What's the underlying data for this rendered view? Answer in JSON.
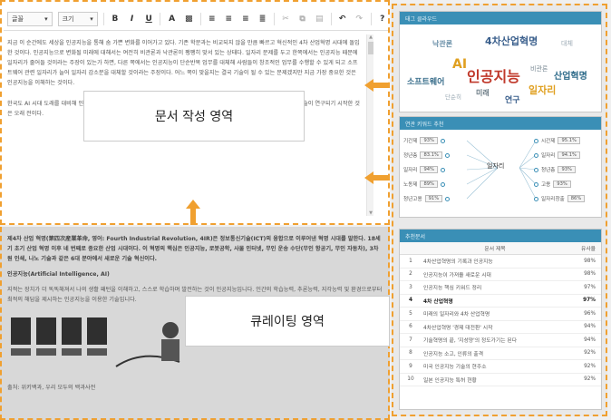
{
  "toolbar": {
    "font_select": "글꼴",
    "size_select": "크기",
    "bold": "B",
    "italic": "I",
    "underline": "U",
    "font_color": "A",
    "help": "?"
  },
  "editor": {
    "paragraphs": [
      "지금 이 순간에도 세상을 인공지능을 통해 숨 가쁜 변화를 이어가고 있다. 기존 학문과는 비교되지 않을 만큼 빠르고 혁신적인 4차 산업혁명 시대에 돌입한 것이다. 인공지능으로 변화될 미래에 대해서는 여전히 비관론과 낙관론이 팽팽히 맞서 있는 상태다. 일자리 문제를 두고 한쪽에서는 인공지능 때문에 일자리가 줄어들 것이라는 주장이 있는가 하면, 다른 쪽에서는 인공지능이 단순반복 업무를 대체해 사람들이 창조적인 업무를 수행할 수 있게 되고 소프트웨어 관련 일자리가 늘어 일자리 감소분을 대체할 것이라는 주장이다. 어느 쪽이 맞을지는 결국 기술이 될 수 있는 문제겠지만 지금 가장 중요한 것은 인공지능을 이해하는 것이다.",
      "한국도 AI 시대 도래를 대비해 인공지능 관련 정책을 발표하고 연구개발 투자를 확대하는 등 대응을 추진한 편이다. 인공지능 기술이 연구되기 시작한 것은 오래 전이다."
    ]
  },
  "labels": {
    "writing_area": "문서 작성 영역",
    "curating_area": "큐레이팅 영역"
  },
  "lower": {
    "line1": "제4차 산업 혁명(第四次産業革命, 영어: Fourth Industrial Revolution, 4IR)은 정보통신기술(ICT)의 융합으로 이루어낸 혁명 시대를 말한다. 18세기 초기 산업 혁명 이후 네 번째로 중요한 산업 시대이다. 이 혁명의 핵심은 인공지능, 로봇공학, 사물 인터넷, 무인 운송 수단(무인 항공기, 무인 자동차), 3차원 인쇄, 나노 기술과 같은 6대 분야에서 새로운 기술 혁신이다.",
    "heading": "인공지능(Artificial Intelligence, AI)",
    "line2": "지적는 장치가 더 똑똑해져서 나의 생활 패턴을 이해하고, 스스로 학습하며 발전하는 것이 인공지능입니다. 인간의 학습능력, 추론능력, 지각능력 및 환경으로부터 최적의 해답을 제시하는 인공지능을 이용한 기술입니다.",
    "caption": "출처: 위키백과, 우리 모두의 백과사전"
  },
  "word_cloud": {
    "title": "태그 클라우드",
    "words": [
      {
        "text": "4차산업혁명",
        "color": "#3a5f8c"
      },
      {
        "text": "낙관론",
        "color": "#6a8fa8"
      },
      {
        "text": "대체",
        "color": "#9aa9b3"
      },
      {
        "text": "AI",
        "color": "#e0a020"
      },
      {
        "text": "인공지능",
        "color": "#c0392b"
      },
      {
        "text": "비관론",
        "color": "#7a8a94"
      },
      {
        "text": "산업혁명",
        "color": "#2e6b8a"
      },
      {
        "text": "소프트웨어",
        "color": "#3b6f8c"
      },
      {
        "text": "일자리",
        "color": "#e0a020"
      },
      {
        "text": "단순히",
        "color": "#9aa9b3"
      },
      {
        "text": "미래",
        "color": "#6a7a84"
      },
      {
        "text": "연구",
        "color": "#3a5f8c"
      }
    ]
  },
  "related": {
    "title": "연관 키워드 추천",
    "center": "일자리",
    "left": [
      {
        "k": "기간제",
        "p": "93%"
      },
      {
        "k": "정년층",
        "p": "83.1%"
      },
      {
        "k": "일자리",
        "p": "94%"
      },
      {
        "k": "노동제",
        "p": "89%"
      },
      {
        "k": "청년고용",
        "p": "91%"
      }
    ],
    "right": [
      {
        "k": "시간제",
        "p": "95.1%"
      },
      {
        "k": "일자리",
        "p": "94.1%"
      },
      {
        "k": "청년층",
        "p": "93%"
      },
      {
        "k": "고용",
        "p": "93%"
      },
      {
        "k": "일자리창출",
        "p": "86%"
      }
    ]
  },
  "recommend": {
    "title": "추천문서",
    "headers": [
      "",
      "문서 제목",
      "유사율"
    ],
    "rows": [
      {
        "n": "1",
        "t": "4차산업혁명의 기록과 인공지능",
        "s": "98%"
      },
      {
        "n": "2",
        "t": "인공지능이 가져올 새로운 시대",
        "s": "98%"
      },
      {
        "n": "3",
        "t": "인공지능 핵심 키워드 정리",
        "s": "97%"
      },
      {
        "n": "4",
        "t": "4차 산업혁명",
        "s": "97%"
      },
      {
        "n": "5",
        "t": "미래의 일자리와 4차 산업혁명",
        "s": "96%"
      },
      {
        "n": "6",
        "t": "4차산업혁명 '경제 대전환' 시작",
        "s": "94%"
      },
      {
        "n": "7",
        "t": "기술혁명의 끝, '지성양'의 정도가기는 된다",
        "s": "94%"
      },
      {
        "n": "8",
        "t": "인공지능 소고, 인류의 출격",
        "s": "92%"
      },
      {
        "n": "9",
        "t": "미국 인공지능 기술의 현주소",
        "s": "92%"
      },
      {
        "n": "10",
        "t": "일본 인공지능 특허 현황",
        "s": "92%"
      }
    ]
  },
  "colors": {
    "accent": "#f0a030",
    "header": "#3a8fb6"
  }
}
